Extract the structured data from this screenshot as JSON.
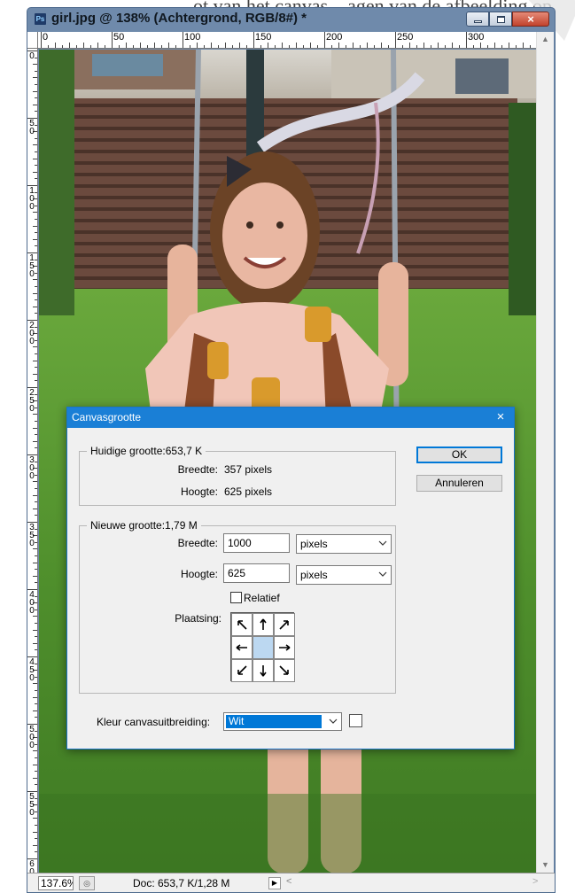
{
  "background_text": "…ot van het canvas…agen van de afbeelding op",
  "window": {
    "app_badge": "Ps",
    "title": "girl.jpg @ 138% (Achtergrond, RGB/8#) *",
    "controls": {
      "minimize": "minimize",
      "maximize": "maximize",
      "close": "×"
    }
  },
  "rulers": {
    "top_labels": [
      "0",
      "50",
      "100",
      "150",
      "200",
      "250",
      "300",
      "3"
    ],
    "left_labels": [
      "0",
      "50",
      "100",
      "150",
      "200",
      "250",
      "300",
      "350",
      "400",
      "450",
      "500",
      "550",
      "600"
    ]
  },
  "status_bar": {
    "zoom": "137.6%",
    "doc_info": "Doc: 653,7 K/1,28 M",
    "menu_arrow": "▶"
  },
  "dialog": {
    "title": "Canvasgrootte",
    "close": "×",
    "current_size": {
      "legend": "Huidige grootte:653,7 K",
      "width_label": "Breedte:",
      "width_value": "357 pixels",
      "height_label": "Hoogte:",
      "height_value": "625 pixels"
    },
    "new_size": {
      "legend": "Nieuwe grootte:1,79 M",
      "width_label": "Breedte:",
      "width_value": "1000",
      "width_unit": "pixels",
      "height_label": "Hoogte:",
      "height_value": "625",
      "height_unit": "pixels",
      "relative_label": "Relatief",
      "relative_checked": false,
      "anchor_label": "Plaatsing:",
      "anchor_selected": "center"
    },
    "extension_color": {
      "label": "Kleur canvasuitbreiding:",
      "value": "Wit",
      "swatch_color": "#ffffff"
    },
    "ok_label": "OK",
    "cancel_label": "Annuleren"
  },
  "colors": {
    "dialog_title_bar": "#1a7fd6",
    "selection_blue": "#0078d7",
    "window_frame": "#6f8aab",
    "anchor_center": "#bcd8f1"
  }
}
